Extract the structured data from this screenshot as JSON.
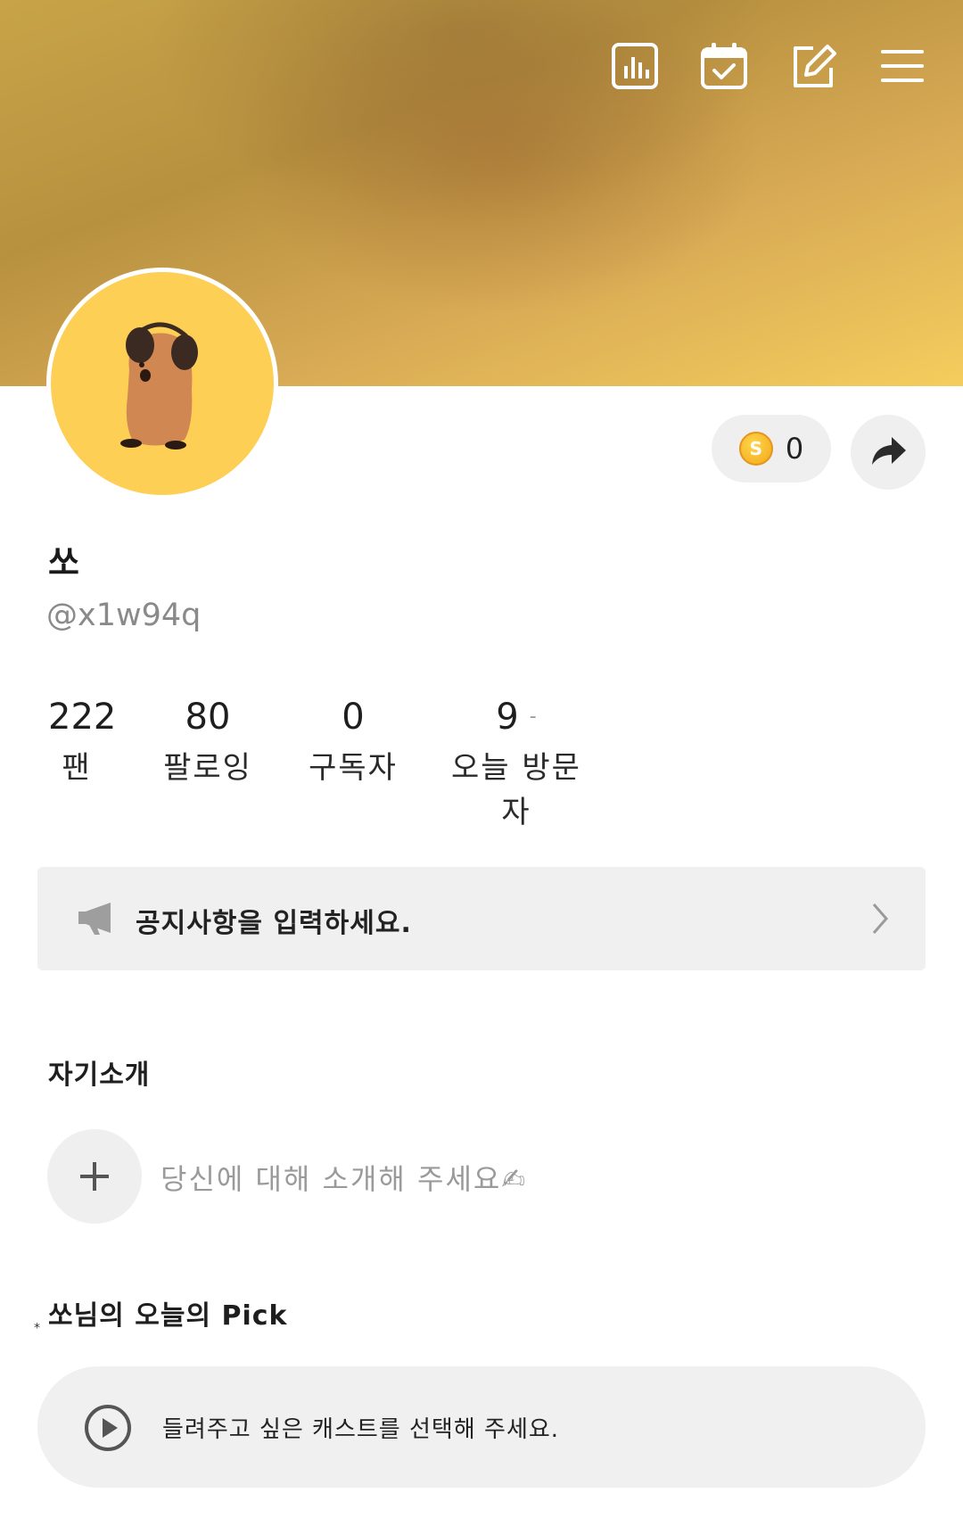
{
  "header": {
    "icons": [
      "stats-icon",
      "calendar-check-icon",
      "edit-icon",
      "menu-icon"
    ]
  },
  "profile": {
    "nickname": "쏘",
    "handle": "@x1w94q",
    "coin_count": "0",
    "coin_symbol": "S"
  },
  "stats": [
    {
      "value": "222",
      "label": "팬"
    },
    {
      "value": "80",
      "label": "팔로잉"
    },
    {
      "value": "0",
      "label": "구독자"
    },
    {
      "value": "9",
      "label": "오늘 방문자",
      "change": "-"
    }
  ],
  "notice": {
    "text": "공지사항을 입력하세요."
  },
  "intro": {
    "title": "자기소개",
    "placeholder": "당신에 대해 소개해 주세요✍"
  },
  "pick": {
    "title": "쏘님의 오늘의 Pick",
    "placeholder": "들려주고 싶은 캐스트를 선택해 주세요."
  },
  "colors": {
    "banner_dark": "#b8913f",
    "banner_light": "#f4cd5d",
    "avatar_bg": "#fecf55",
    "pill_bg": "#efefef"
  }
}
